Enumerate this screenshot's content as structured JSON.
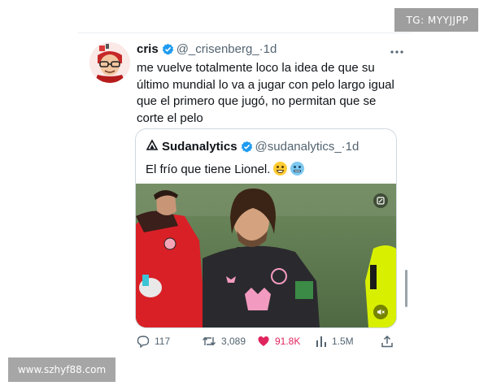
{
  "overlay": {
    "tg_label": "TG: MYYJJPP",
    "site_watermark": "www.szhyf88.com"
  },
  "tweet": {
    "author_name": "cris",
    "author_handle": "@_crisenberg_",
    "separator": "·",
    "time": "1d",
    "more_icon": "more-horizontal-icon",
    "avatar_icon": "cartoon-avatar",
    "verified_color": "#1d9bf0",
    "text": "me vuelve totalmente loco la idea de que su último mundial lo va a jugar con pelo largo igual que el primero que jugó, no permitan que se corte el pelo"
  },
  "quoted_tweet": {
    "author_name": "Sudanalytics",
    "author_handle": "@sudanalytics_",
    "separator": "·",
    "time": "1d",
    "logo_icon": "triangle-logo-icon",
    "text": "El frío que tiene Lionel.",
    "emojis": [
      "grimacing-face",
      "cold-face"
    ],
    "video_icons": [
      "gif-toggle-icon",
      "mute-icon"
    ]
  },
  "actions": {
    "replies": "117",
    "reposts": "3,089",
    "likes": "91.8K",
    "views": "1.5M",
    "like_color": "#e0245e",
    "icons": [
      "reply-icon",
      "repost-icon",
      "like-icon",
      "views-icon",
      "share-icon"
    ]
  }
}
